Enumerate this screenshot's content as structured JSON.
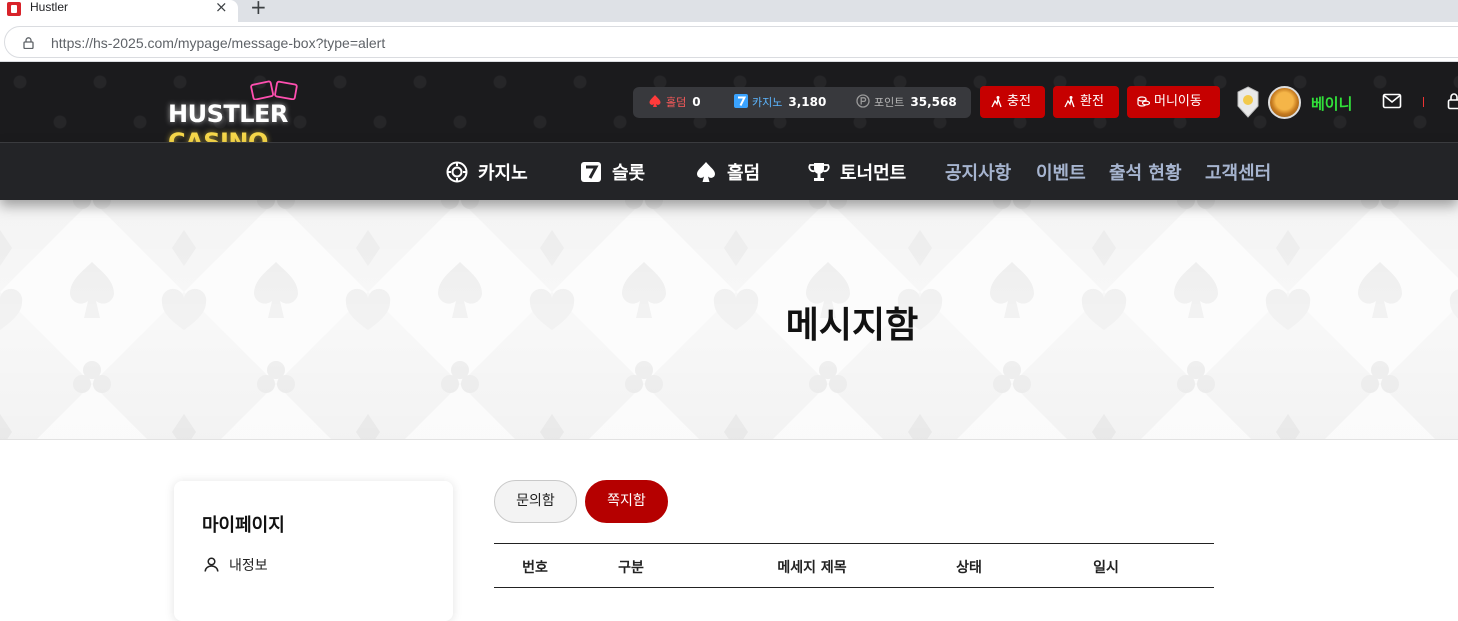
{
  "browser": {
    "tab_title": "Hustler",
    "url_host": "https://hs-2025.com",
    "url_path": "/mypage/message-box?type=alert"
  },
  "header": {
    "logo_left": "HUSTLER",
    "logo_right": "CASINO",
    "balances": [
      {
        "label": "홀덤",
        "value": "0",
        "icon": "spade-icon",
        "color": "#ff3b3b"
      },
      {
        "label": "카지노",
        "value": "3,180",
        "icon": "seven-icon",
        "color": "#3aa3ff"
      },
      {
        "label": "포인트",
        "value": "35,568",
        "icon": "point-icon",
        "color": "#9a9a9a"
      }
    ],
    "buttons": {
      "charge": "충전",
      "exchange": "환전",
      "money_move": "머니이동"
    },
    "username": "베이니",
    "accent": "#c60000"
  },
  "nav": {
    "items": [
      {
        "label": "카지노",
        "icon": "chip-icon"
      },
      {
        "label": "슬롯",
        "icon": "seven-icon"
      },
      {
        "label": "홀덤",
        "icon": "spade-icon"
      },
      {
        "label": "토너먼트",
        "icon": "trophy-icon"
      }
    ],
    "links": [
      "공지사항",
      "이벤트",
      "출석 현황",
      "고객센터"
    ]
  },
  "hero": {
    "title": "메시지함"
  },
  "sidebar": {
    "title": "마이페이지",
    "items": [
      {
        "label": "내정보",
        "icon": "user-icon"
      }
    ]
  },
  "tabs": {
    "inquiry": "문의함",
    "message": "쪽지함"
  },
  "table": {
    "columns": [
      "번호",
      "구분",
      "메세지 제목",
      "상태",
      "일시"
    ]
  }
}
